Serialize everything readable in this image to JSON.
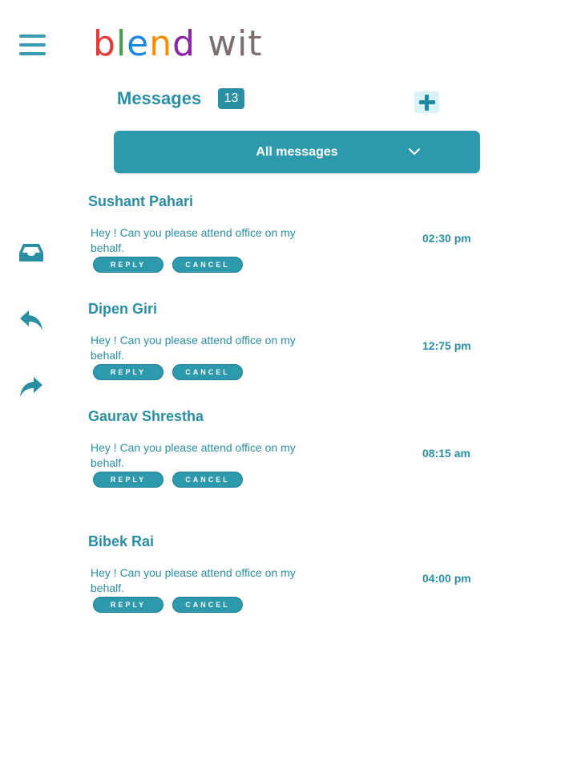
{
  "header": {
    "logo_parts": [
      "b",
      "l",
      "e",
      "n",
      "d",
      "wit"
    ],
    "title": "Messages",
    "count": "13"
  },
  "filter": {
    "selected": "All messages"
  },
  "sidebar": {
    "icons": [
      "inbox-icon",
      "reply-icon",
      "forward-icon"
    ]
  },
  "messages": [
    {
      "sender": "Sushant Pahari",
      "body": "Hey ! Can you please attend office on my behalf.",
      "time": "02:30 pm",
      "reply_label": "REPLY",
      "cancel_label": "CANCEL"
    },
    {
      "sender": "Dipen Giri",
      "body": "Hey ! Can you please attend office on my behalf.",
      "time": "12:75 pm",
      "reply_label": "REPLY",
      "cancel_label": "CANCEL"
    },
    {
      "sender": "Gaurav Shrestha",
      "body": "Hey ! Can you please attend office on my behalf.",
      "time": "08:15 am",
      "reply_label": "REPLY",
      "cancel_label": "CANCEL"
    },
    {
      "sender": "Bibek Rai",
      "body": "Hey ! Can you please attend office on my behalf.",
      "time": "04:00 pm",
      "reply_label": "REPLY",
      "cancel_label": "CANCEL"
    }
  ],
  "colors": {
    "primary": "#2c99ad",
    "text": "#2a8fa3",
    "add_bg": "#d8f2f6"
  }
}
